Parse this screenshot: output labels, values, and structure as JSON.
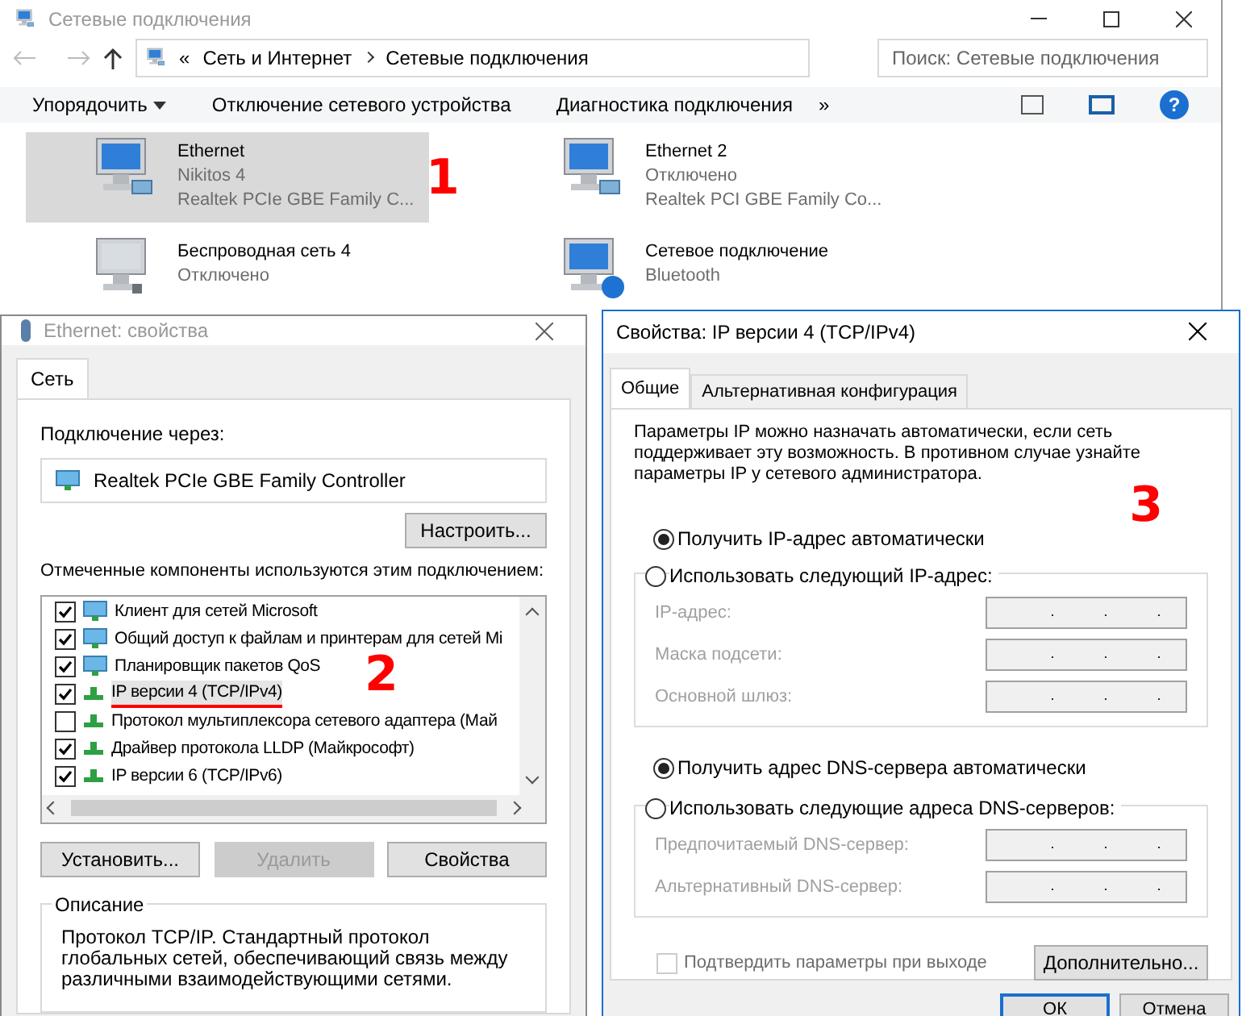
{
  "explorer": {
    "title": "Сетевые подключения",
    "breadcrumbs": [
      "Сеть и Интернет",
      "Сетевые подключения"
    ],
    "breadcrumb_prefix": "«",
    "search": {
      "placeholder": "Поиск: Сетевые подключения"
    },
    "toolbar": [
      "Упорядочить",
      "Отключение сетевого устройства",
      "Диагностика подключения"
    ],
    "toolbar_more": "»",
    "help": "?",
    "connections": [
      {
        "name": "Ethernet",
        "status": "Nikitos  4",
        "adapter": "Realtek PCIe GBE Family C...",
        "selected": true,
        "kind": "wired"
      },
      {
        "name": "Ethernet 2",
        "status": "Отключено",
        "adapter": "Realtek PCI GBE Family Co...",
        "selected": false,
        "kind": "wired"
      },
      {
        "name": "Беспроводная сеть 4",
        "status": "Отключено",
        "selected": false,
        "kind": "wireless"
      },
      {
        "name": "Сетевое подключение",
        "status": "Bluetooth",
        "selected": false,
        "kind": "bluetooth"
      }
    ]
  },
  "ethernet_dialog": {
    "title": "Ethernet: свойства",
    "tabs": [
      {
        "label": "Сеть",
        "selected": true
      }
    ],
    "connect_label": "Подключение через:",
    "adapter": "Realtek PCIe GBE Family Controller",
    "configure_button": "Настроить...",
    "components_label": "Отмеченные компоненты используются этим подключением:",
    "components": [
      {
        "label": "Клиент для сетей Microsoft",
        "checked": true,
        "selected": false,
        "kind": "client"
      },
      {
        "label": "Общий доступ к файлам и принтерам для сетей Mi",
        "checked": true,
        "selected": false,
        "kind": "client"
      },
      {
        "label": "Планировщик пакетов QoS",
        "checked": true,
        "selected": false,
        "kind": "client"
      },
      {
        "label": "IP версии 4 (TCP/IPv4)",
        "checked": true,
        "selected": true,
        "kind": "protocol"
      },
      {
        "label": "Протокол мультиплексора сетевого адаптера (Май",
        "checked": false,
        "selected": false,
        "kind": "protocol"
      },
      {
        "label": "Драйвер протокола LLDP (Майкрософт)",
        "checked": true,
        "selected": false,
        "kind": "protocol"
      },
      {
        "label": "IP версии 6 (TCP/IPv6)",
        "checked": true,
        "selected": false,
        "kind": "protocol"
      }
    ],
    "buttons": [
      {
        "label": "Установить...",
        "disabled": false
      },
      {
        "label": "Удалить",
        "disabled": true
      },
      {
        "label": "Свойства",
        "disabled": false
      }
    ],
    "description_title": "Описание",
    "description": "Протокол TCP/IP. Стандартный протокол глобальных сетей, обеспечивающий связь между различными взаимодействующими сетями."
  },
  "ipv4_dialog": {
    "title": "Свойства: IP версии 4 (TCP/IPv4)",
    "tabs": [
      {
        "label": "Общие",
        "selected": true
      },
      {
        "label": "Альтернативная конфигурация",
        "selected": false
      }
    ],
    "intro": "Параметры IP можно назначать автоматически, если сеть поддерживает эту возможность. В противном случае узнайте параметры IP у сетевого администратора.",
    "ip_auto": {
      "label": "Получить IP-адрес автоматически",
      "selected": true
    },
    "ip_manual": {
      "label": "Использовать следующий IP-адрес:",
      "selected": false
    },
    "ip_fields": [
      {
        "label": "IP-адрес:",
        "separators": [
          ".",
          ".",
          "."
        ],
        "disabled": true
      },
      {
        "label": "Маска подсети:",
        "separators": [
          ".",
          ".",
          "."
        ],
        "disabled": true
      },
      {
        "label": "Основной шлюз:",
        "separators": [
          ".",
          ".",
          "."
        ],
        "disabled": true
      }
    ],
    "dns_auto": {
      "label": "Получить адрес DNS-сервера автоматически",
      "selected": true
    },
    "dns_manual": {
      "label": "Использовать следующие адреса DNS-серверов:",
      "selected": false
    },
    "dns_fields": [
      {
        "label": "Предпочитаемый DNS-сервер:",
        "separators": [
          ".",
          ".",
          "."
        ],
        "disabled": true
      },
      {
        "label": "Альтернативный DNS-сервер:",
        "separators": [
          ".",
          ".",
          "."
        ],
        "disabled": true
      }
    ],
    "validate": {
      "label": "Подтвердить параметры при выходе",
      "checked": false,
      "disabled": true
    },
    "advanced_button": "Дополнительно...",
    "footer_buttons": [
      "ОК",
      "Отмена"
    ]
  },
  "annotations": [
    "1",
    "2",
    "3"
  ]
}
